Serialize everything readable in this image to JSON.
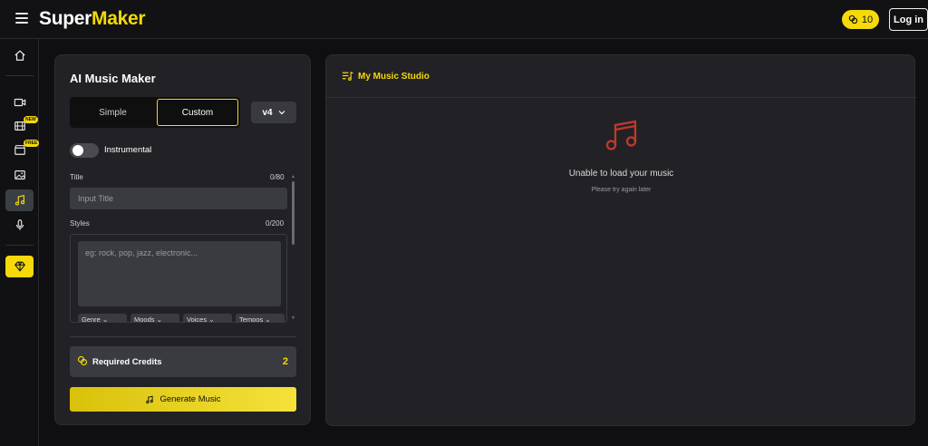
{
  "app": {
    "brand_part1": "Super",
    "brand_part2": "Maker",
    "brand_accent": "#f5d90a"
  },
  "header": {
    "credits": "10",
    "login_label": "Log in"
  },
  "sidebar": {
    "items": [
      {
        "name": "home",
        "icon": "home-icon"
      },
      {
        "name": "video",
        "icon": "video-camera-icon"
      },
      {
        "name": "film",
        "icon": "film-icon",
        "badge": "NEW"
      },
      {
        "name": "clapper",
        "icon": "clapperboard-icon",
        "badge": "FREE"
      },
      {
        "name": "image",
        "icon": "image-icon"
      },
      {
        "name": "music",
        "icon": "music-note-icon",
        "active": true
      },
      {
        "name": "voice",
        "icon": "microphone-icon"
      },
      {
        "name": "premium",
        "icon": "diamond-icon"
      }
    ]
  },
  "maker": {
    "title": "AI Music Maker",
    "mode_simple": "Simple",
    "mode_custom": "Custom",
    "selected_mode": "Custom",
    "version": "v4",
    "instrumental_label": "Instrumental",
    "instrumental_on": false,
    "title_label": "Title",
    "title_counter": "0/80",
    "title_placeholder": "Input Title",
    "styles_label": "Styles",
    "styles_counter": "0/200",
    "styles_placeholder": "eg: rock, pop, jazz, electronic...",
    "chips": [
      "Genre",
      "Moods",
      "Voices",
      "Tempos"
    ],
    "required_credits_label": "Required Credits",
    "required_credits_value": "2",
    "generate_label": "Generate Music"
  },
  "studio": {
    "title": "My Music Studio",
    "empty_title": "Unable to load your music",
    "empty_subtitle": "Please try again later",
    "error_color": "#c0392b"
  }
}
